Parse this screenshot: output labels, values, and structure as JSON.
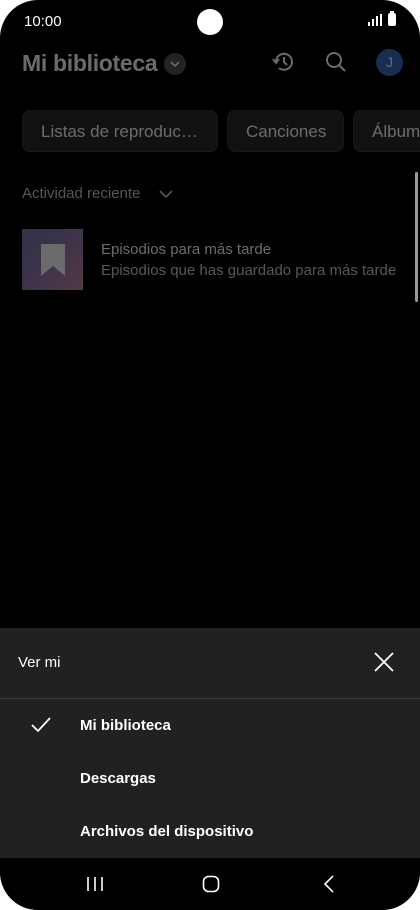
{
  "status": {
    "time": "10:00"
  },
  "header": {
    "title": "Mi biblioteca",
    "avatar_letter": "J"
  },
  "chips": [
    "Listas de reproduc…",
    "Canciones",
    "Álbum"
  ],
  "recent": {
    "label": "Actividad reciente",
    "item": {
      "title": "Episodios para más tarde",
      "subtitle": "Episodios que has guardado para más tarde"
    }
  },
  "sheet": {
    "title": "Ver mi",
    "options": [
      {
        "label": "Mi biblioteca",
        "selected": true
      },
      {
        "label": "Descargas",
        "selected": false
      },
      {
        "label": "Archivos del dispositivo",
        "selected": false
      }
    ]
  },
  "colors": {
    "background": "#000000",
    "sheet": "#212121",
    "avatar": "#3a6fc0"
  }
}
